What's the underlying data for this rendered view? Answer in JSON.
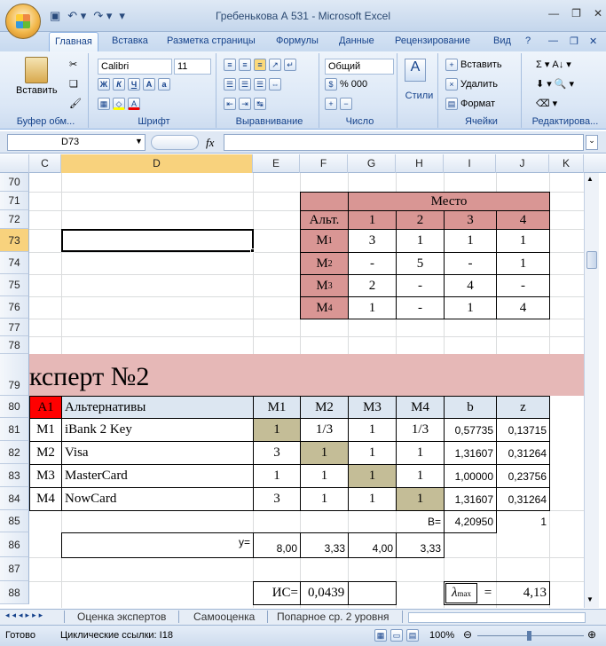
{
  "window": {
    "title": "Гребенькова А 531 - Microsoft Excel"
  },
  "tabs": [
    "Главная",
    "Вставка",
    "Разметка страницы",
    "Формулы",
    "Данные",
    "Рецензирование",
    "Вид"
  ],
  "ribbon": {
    "clipboard": {
      "paste": "Вставить",
      "label": "Буфер обм..."
    },
    "font": {
      "name": "Calibri",
      "size": "11",
      "label": "Шрифт"
    },
    "align": {
      "label": "Выравнивание"
    },
    "number": {
      "format": "Общий",
      "label": "Число",
      "percent": "%",
      "thousands": "000"
    },
    "styles": {
      "label": "Стили"
    },
    "cells": {
      "insert": "Вставить",
      "delete": "Удалить",
      "format": "Формат",
      "label": "Ячейки"
    },
    "edit": {
      "label": "Редактирова..."
    }
  },
  "formula_bar": {
    "name_box": "D73",
    "fx": "fx",
    "value": ""
  },
  "columns": [
    "C",
    "D",
    "E",
    "F",
    "G",
    "H",
    "I",
    "J",
    "K"
  ],
  "rows": [
    "70",
    "71",
    "72",
    "73",
    "74",
    "75",
    "76",
    "77",
    "78",
    "79",
    "80",
    "81",
    "82",
    "83",
    "84",
    "85",
    "86",
    "87",
    "88"
  ],
  "place_table": {
    "title": "Место",
    "alt": "Альт.",
    "headers": [
      "1",
      "2",
      "3",
      "4"
    ],
    "rows": [
      {
        "m": "M",
        "sub": "1",
        "v": [
          "3",
          "1",
          "1",
          "1"
        ]
      },
      {
        "m": "M",
        "sub": "2",
        "v": [
          "-",
          "5",
          "-",
          "1"
        ]
      },
      {
        "m": "M",
        "sub": "3",
        "v": [
          "2",
          "-",
          "4",
          "-"
        ]
      },
      {
        "m": "M",
        "sub": "4",
        "v": [
          "1",
          "-",
          "1",
          "4"
        ]
      }
    ]
  },
  "expert_title": "ксперт №2",
  "main_table": {
    "a1": "A1",
    "alt": "Альтернативы",
    "headers": [
      "M1",
      "M2",
      "M3",
      "M4",
      "b",
      "z"
    ],
    "rows": [
      {
        "id": "M1",
        "name": "iBank 2 Key",
        "v": [
          "1",
          "1/3",
          "1",
          "1/3"
        ],
        "b": "0,57735",
        "z": "0,13715"
      },
      {
        "id": "M2",
        "name": "Visa",
        "v": [
          "3",
          "1",
          "1",
          "1"
        ],
        "b": "1,31607",
        "z": "0,31264"
      },
      {
        "id": "M3",
        "name": "MasterCard",
        "v": [
          "1",
          "1",
          "1",
          "1"
        ],
        "b": "1,00000",
        "z": "0,23756"
      },
      {
        "id": "M4",
        "name": "NowCard",
        "v": [
          "3",
          "1",
          "1",
          "1"
        ],
        "b": "1,31607",
        "z": "0,31264"
      }
    ],
    "B_label": "B=",
    "B_value": "4,20950",
    "J85": "1",
    "y_label": "y=",
    "y_values": [
      "8,00",
      "3,33",
      "4,00",
      "3,33"
    ],
    "is_label": "ИС=",
    "is_value": "0,0439",
    "lmax_label": "λ",
    "lmax_sub": "max",
    "lmax_eq": "=",
    "lmax_value": "4,13"
  },
  "sheet_tabs": [
    "Оценка экспертов",
    "Самооценка",
    "Попарное ср. 2 уровня"
  ],
  "status": {
    "ready": "Готово",
    "circular": "Циклические ссылки: I18",
    "zoom": "100%"
  },
  "colors": {
    "pink": "#d99694",
    "pink_light": "#e6b8b7",
    "red": "#ff0000",
    "highlight": "#c4bd97",
    "header_blue": "#dce6f1"
  }
}
